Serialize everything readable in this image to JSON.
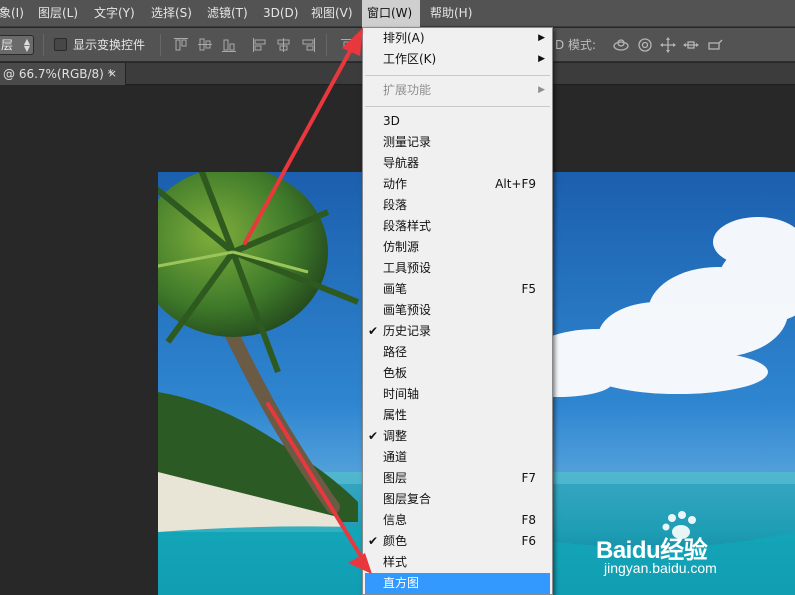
{
  "menubar": {
    "items": [
      "象(I)",
      "图层(L)",
      "文字(Y)",
      "选择(S)",
      "滤镜(T)",
      "3D(D)",
      "视图(V)",
      "窗口(W)",
      "帮助(H)"
    ],
    "active": "窗口(W)"
  },
  "options_bar": {
    "layer_select": "层",
    "checkbox_label": "显示变换控件",
    "mode_3d_label": "D 模式:"
  },
  "document_tab": {
    "title": "@ 66.7%(RGB/8) *",
    "close": "×"
  },
  "window_menu": {
    "items": [
      {
        "label": "排列(A)",
        "submenu": true
      },
      {
        "label": "工作区(K)",
        "submenu": true
      },
      {
        "label": "扩展功能",
        "submenu": true,
        "disabled": true
      },
      {
        "label": "3D"
      },
      {
        "label": "测量记录"
      },
      {
        "label": "导航器"
      },
      {
        "label": "动作",
        "shortcut": "Alt+F9"
      },
      {
        "label": "段落"
      },
      {
        "label": "段落样式"
      },
      {
        "label": "仿制源"
      },
      {
        "label": "工具预设"
      },
      {
        "label": "画笔",
        "shortcut": "F5"
      },
      {
        "label": "画笔预设"
      },
      {
        "label": "历史记录",
        "checked": true
      },
      {
        "label": "路径"
      },
      {
        "label": "色板"
      },
      {
        "label": "时间轴"
      },
      {
        "label": "属性"
      },
      {
        "label": "调整",
        "checked": true
      },
      {
        "label": "通道"
      },
      {
        "label": "图层",
        "shortcut": "F7"
      },
      {
        "label": "图层复合"
      },
      {
        "label": "信息",
        "shortcut": "F8"
      },
      {
        "label": "颜色",
        "shortcut": "F6",
        "checked": true
      },
      {
        "label": "样式"
      },
      {
        "label": "直方图",
        "highlighted": true
      }
    ],
    "check_glyph": "✔",
    "submenu_glyph": "▶"
  },
  "watermark": {
    "brand": "Baidu经验",
    "url": "jingyan.baidu.com"
  },
  "colors": {
    "menu_highlight": "#3399ff",
    "annotation_red": "#e8383d",
    "ui_dark": "#535353"
  }
}
